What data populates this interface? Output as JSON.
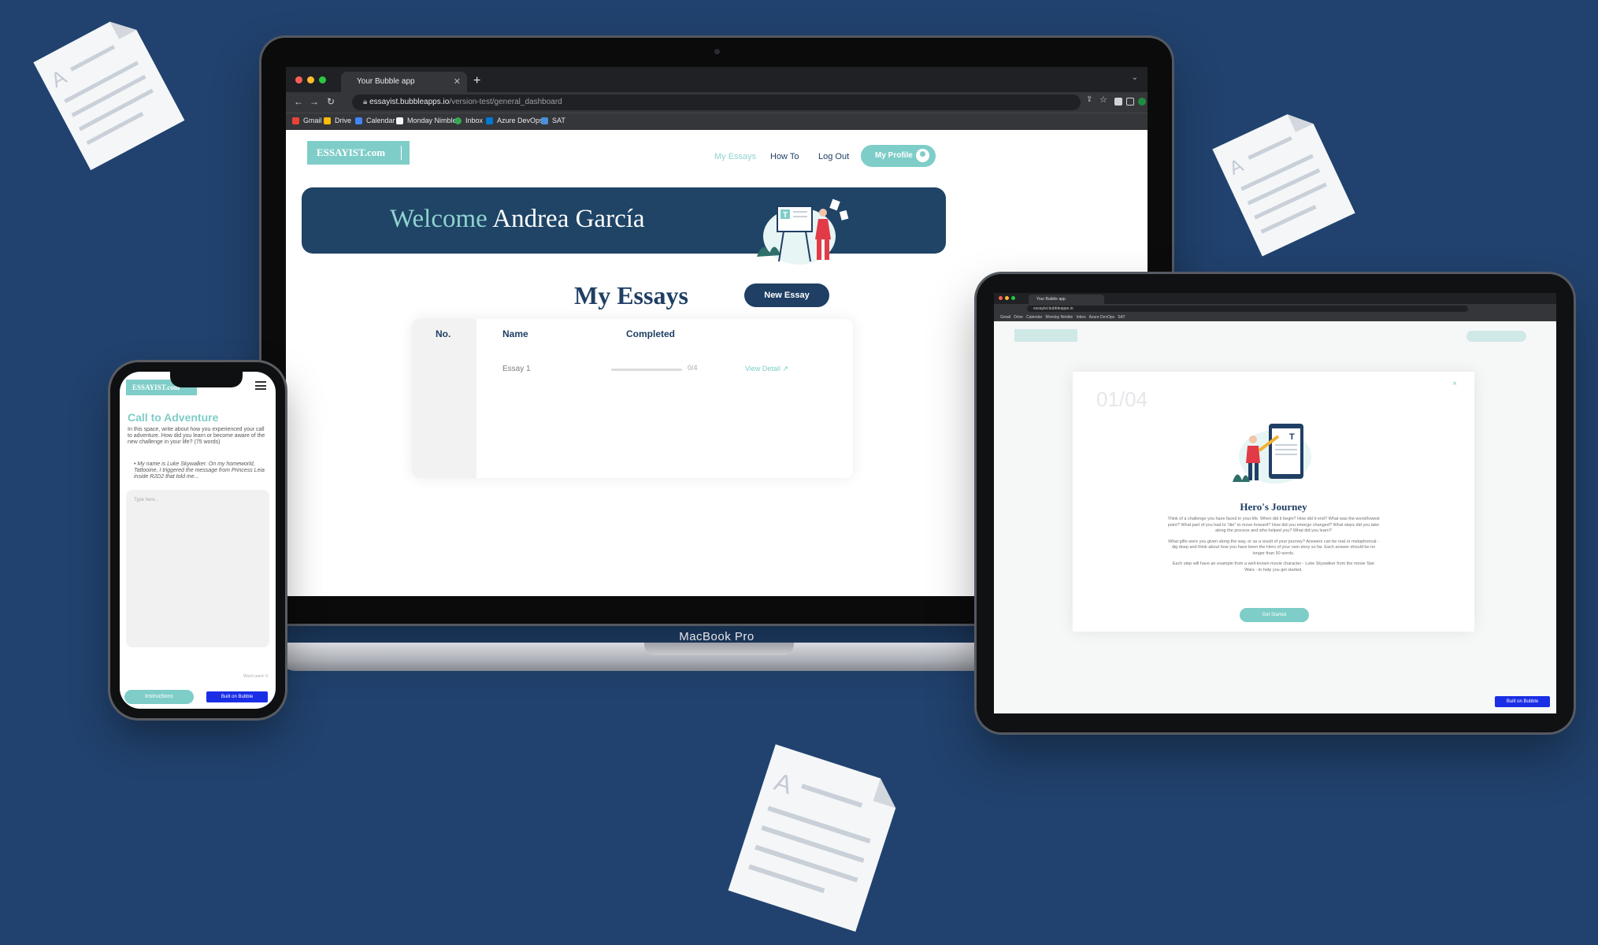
{
  "browser": {
    "tab_title": "Your Bubble app",
    "url_domain": "essayist.bubbleapps.io",
    "url_path": "/version-test/general_dashboard",
    "bookmarks": [
      {
        "label": "Gmail",
        "color": "#ea4335"
      },
      {
        "label": "Drive",
        "color": "#fbbc04"
      },
      {
        "label": "Calendar",
        "color": "#4285f4"
      },
      {
        "label": "Monday Nimble",
        "color": "#f6f6f6"
      },
      {
        "label": "Inbox",
        "color": "#34a853"
      },
      {
        "label": "Azure DevOps",
        "color": "#0078d4"
      },
      {
        "label": "SAT",
        "color": "#4a90d9"
      }
    ]
  },
  "site": {
    "logo": "ESSAYIST.com",
    "nav": {
      "my_essays": "My Essays",
      "how_to": "How To",
      "log_out": "Log Out",
      "my_profile": "My Profile"
    },
    "welcome_word": "Welcome",
    "user_name": "Andrea García",
    "section_title": "My Essays",
    "new_essay": "New Essay",
    "table": {
      "headers": [
        "No.",
        "Name",
        "Completed"
      ],
      "rows": [
        {
          "name": "Essay 1",
          "progress": "0/4",
          "progress_fraction": 0.0,
          "action": "View Detail"
        }
      ]
    }
  },
  "laptop_label": "MacBook Pro",
  "tablet": {
    "step": "01/04",
    "close": "×",
    "title": "Hero's Journey",
    "paragraphs": [
      "Think of a challenge you have faced in your life. When did it begin? How did it end? What was the worst/lowest point? What part of you had to \"die\" to move forward? How did you emerge changed? What steps did you take along the process and who helped you? What did you learn?",
      "What gifts were you given along the way, or as a result of your journey? Answers can be real or metaphorical - dig deep and think about how you have been the Hero of your own story so far. Each answer should be no longer than 50 words.",
      "Each step will have an example from a well-known movie character - Luke Skywalker from the movie Star Wars - to help you get started."
    ],
    "get_started": "Get Started",
    "built_on": "Built on Bubble"
  },
  "phone": {
    "logo": "ESSAYIST.com",
    "title": "Call to Adventure",
    "prompt": "In this space, write about how you experienced your call to adventure. How did you learn or become aware of the new challenge in your life? (75 words)",
    "example": "My name is Luke Skywalker. On my homeworld, Tattooine, I triggered the message from Princess Leia inside R2D2 that told me...",
    "placeholder": "Type here...",
    "word_count": "Word count: 0",
    "instructions": "Instructions",
    "built_on": "Built on Bubble"
  },
  "colors": {
    "background": "#21426e",
    "teal": "#7ecdc8",
    "navy": "#1f3f64"
  }
}
